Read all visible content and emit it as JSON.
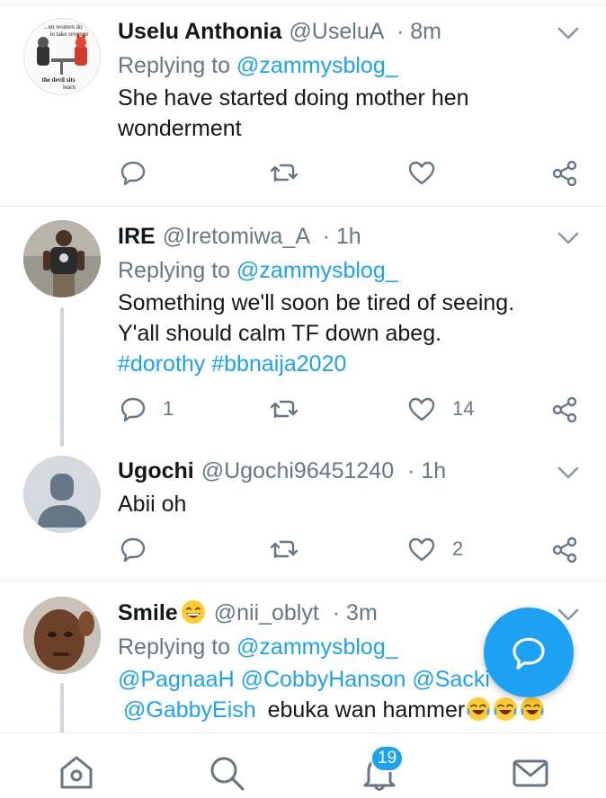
{
  "colors": {
    "accent": "#1da1f2",
    "secondary_text": "#657786",
    "primary_text": "#14171a",
    "divider": "#e6ecf0"
  },
  "tweets": [
    {
      "name": "Uselu Anthonia",
      "handle": "@UseluA",
      "time": "· 8m",
      "replying_prefix": "Replying to",
      "replying_to": "@zammysblog_",
      "text_lines": [
        "She have started doing mother hen",
        "wonderment"
      ],
      "avatar": {
        "caption_top": "...en women do",
        "caption_mid": "to take revenge",
        "caption_bottom": "the devil sits",
        "caption_last": "learn"
      },
      "reply_count": "",
      "retweet_count": "",
      "like_count": ""
    },
    {
      "name": "IRE",
      "handle": "@Iretomiwa_A",
      "time": "· 1h",
      "replying_prefix": "Replying to",
      "replying_to": "@zammysblog_",
      "text_lines": [
        "Something we'll soon be tired of seeing.",
        "Y'all should calm TF down abeg."
      ],
      "hashtags": [
        "#dorothy",
        "#bbnaija2020"
      ],
      "reply_count": "1",
      "retweet_count": "",
      "like_count": "14"
    },
    {
      "name": "Ugochi",
      "handle": "@Ugochi96451240",
      "time": "· 1h",
      "text_lines": [
        "Abii oh"
      ],
      "reply_count": "",
      "retweet_count": "",
      "like_count": "2"
    },
    {
      "name": "Smile",
      "handle": "@nii_oblyt",
      "time": "· 3m",
      "replying_prefix": "Replying to",
      "replying_to": "@zammysblog_",
      "mentions": [
        "@PagnaaH",
        "@CobbyHanson",
        "@Sacki"
      ],
      "mention2": "@GabbyEish",
      "text_tail": "ebuka wan hammer"
    }
  ],
  "icons": {
    "reply": "reply-icon",
    "retweet": "retweet-icon",
    "like": "heart-icon",
    "share": "share-icon",
    "more": "chevron-down-icon",
    "compose": "compose-reply-icon",
    "home": "home-icon",
    "search": "search-icon",
    "notifications": "bell-icon",
    "messages": "mail-icon"
  },
  "bottom_nav": {
    "notifications_badge": "19"
  }
}
